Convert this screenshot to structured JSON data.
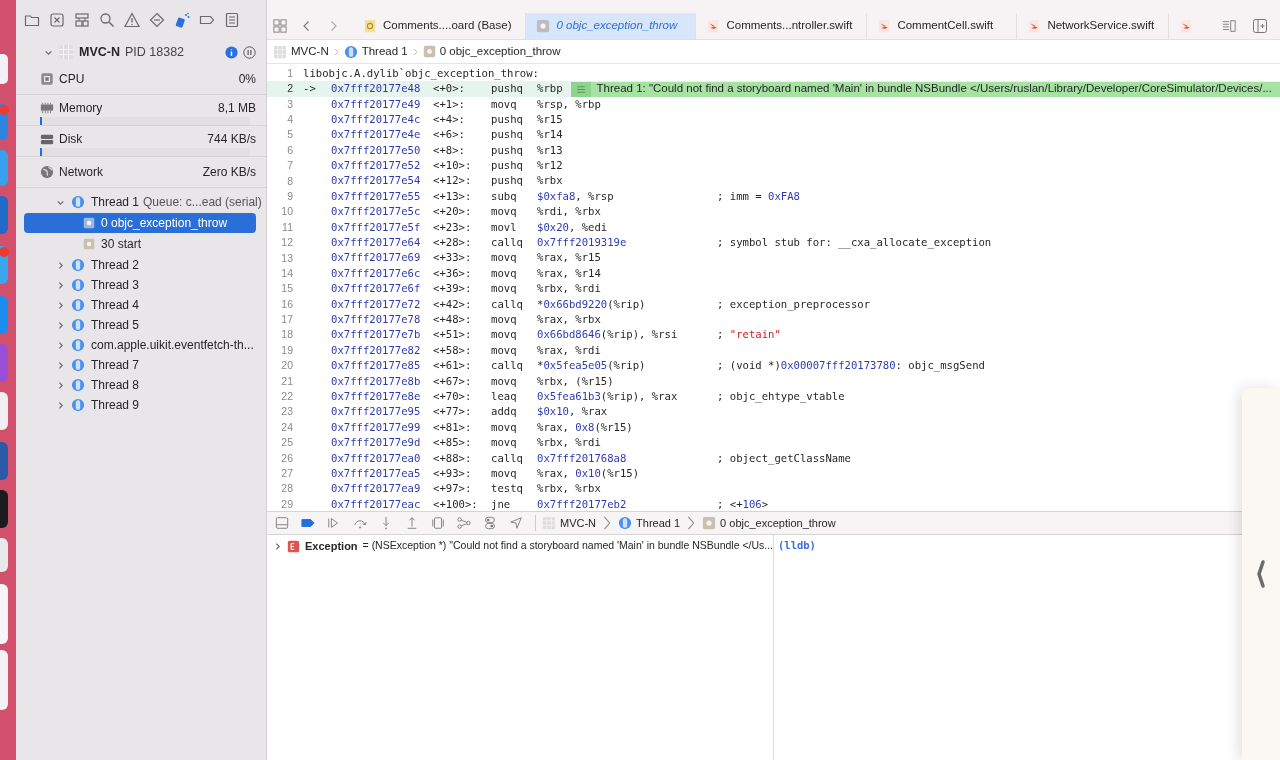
{
  "navigator_icons": [
    {
      "kind": "folder",
      "selected": false
    },
    {
      "kind": "source",
      "selected": false
    },
    {
      "kind": "hierarchy",
      "selected": false
    },
    {
      "kind": "search",
      "selected": false
    },
    {
      "kind": "warning",
      "selected": false
    },
    {
      "kind": "test",
      "selected": false
    },
    {
      "kind": "debug",
      "selected": true
    },
    {
      "kind": "breakpoint",
      "selected": false
    },
    {
      "kind": "report",
      "selected": false
    }
  ],
  "process": {
    "name": "MVC-N",
    "pid": "PID 18382",
    "expanded": true
  },
  "gauges": [
    {
      "kind": "cpu",
      "label": "CPU",
      "value": "0%"
    },
    {
      "kind": "memory",
      "label": "Memory",
      "value": "8,1 MB",
      "level": 0.01
    },
    {
      "kind": "disk",
      "label": "Disk",
      "value": "744 KB/s",
      "level": 0.01
    },
    {
      "kind": "network",
      "label": "Network",
      "value": "Zero KB/s"
    }
  ],
  "threads": [
    {
      "name": "Thread 1",
      "detail": "Queue: c...ead (serial)",
      "expanded": true,
      "children": [
        {
          "label": "0 objc_exception_throw",
          "selected": true
        },
        {
          "label": "30 start",
          "selected": false
        }
      ]
    },
    {
      "name": "Thread 2",
      "expanded": false
    },
    {
      "name": "Thread 3",
      "expanded": false
    },
    {
      "name": "Thread 4",
      "expanded": false
    },
    {
      "name": "Thread 5",
      "expanded": false
    },
    {
      "name": "com.apple.uikit.eventfetch-th...",
      "expanded": false
    },
    {
      "name": "Thread 7",
      "expanded": false
    },
    {
      "name": "Thread 8",
      "expanded": false
    },
    {
      "name": "Thread 9",
      "expanded": false
    }
  ],
  "tabs": [
    {
      "kind": "storyboard",
      "label": "Comments....oard (Base)",
      "selected": false
    },
    {
      "kind": "frame",
      "label": "0 objc_exception_throw",
      "selected": true
    },
    {
      "kind": "swift",
      "label": "Comments...ntroller.swift",
      "selected": false
    },
    {
      "kind": "swift",
      "label": "CommentCell.swift",
      "selected": false
    },
    {
      "kind": "swift",
      "label": "NetworkService.swift",
      "selected": false
    },
    {
      "kind": "swift",
      "selected": false
    }
  ],
  "breadcrumb": [
    "MVC-N",
    "Thread 1",
    "0 objc_exception_throw"
  ],
  "code": {
    "lines": [
      {
        "number": "1",
        "header": "libobjc.A.dylib`objc_exception_throw:"
      },
      {
        "number": "2",
        "current": true,
        "arrow": "->",
        "addr": "0x7fff20177e48",
        "offset": "<+0>:",
        "op": "pushq",
        "args": "%rbp",
        "banner": "Thread 1: \"Could not find a storyboard named 'Main' in bundle NSBundle </Users/ruslan/Library/Developer/CoreSimulator/Devices/..."
      },
      {
        "number": "3",
        "addr": "0x7fff20177e49",
        "offset": "<+1>:",
        "op": "movq",
        "args": "%rsp, %rbp"
      },
      {
        "number": "4",
        "addr": "0x7fff20177e4c",
        "offset": "<+4>:",
        "op": "pushq",
        "args": "%r15"
      },
      {
        "number": "5",
        "addr": "0x7fff20177e4e",
        "offset": "<+6>:",
        "op": "pushq",
        "args": "%r14"
      },
      {
        "number": "6",
        "addr": "0x7fff20177e50",
        "offset": "<+8>:",
        "op": "pushq",
        "args": "%r13"
      },
      {
        "number": "7",
        "addr": "0x7fff20177e52",
        "offset": "<+10>:",
        "op": "pushq",
        "args": "%r12"
      },
      {
        "number": "8",
        "addr": "0x7fff20177e54",
        "offset": "<+12>:",
        "op": "pushq",
        "args": "%rbx"
      },
      {
        "number": "9",
        "addr": "0x7fff20177e55",
        "offset": "<+13>:",
        "op": "subq",
        "args": "$0xfa8, %rsp",
        "comment": "; imm = 0xFA8"
      },
      {
        "number": "10",
        "addr": "0x7fff20177e5c",
        "offset": "<+20>:",
        "op": "movq",
        "args": "%rdi, %rbx"
      },
      {
        "number": "11",
        "addr": "0x7fff20177e5f",
        "offset": "<+23>:",
        "op": "movl",
        "args": "$0x20, %edi"
      },
      {
        "number": "12",
        "addr": "0x7fff20177e64",
        "offset": "<+28>:",
        "op": "callq",
        "args": "0x7fff2019319e",
        "comment": "; symbol stub for: __cxa_allocate_exception"
      },
      {
        "number": "13",
        "addr": "0x7fff20177e69",
        "offset": "<+33>:",
        "op": "movq",
        "args": "%rax, %r15"
      },
      {
        "number": "14",
        "addr": "0x7fff20177e6c",
        "offset": "<+36>:",
        "op": "movq",
        "args": "%rax, %r14"
      },
      {
        "number": "15",
        "addr": "0x7fff20177e6f",
        "offset": "<+39>:",
        "op": "movq",
        "args": "%rbx, %rdi"
      },
      {
        "number": "16",
        "addr": "0x7fff20177e72",
        "offset": "<+42>:",
        "op": "callq",
        "args": "*0x66bd9220(%rip)",
        "comment": "; exception_preprocessor"
      },
      {
        "number": "17",
        "addr": "0x7fff20177e78",
        "offset": "<+48>:",
        "op": "movq",
        "args": "%rax, %rbx"
      },
      {
        "number": "18",
        "addr": "0x7fff20177e7b",
        "offset": "<+51>:",
        "op": "movq",
        "args": "0x66bd8646(%rip), %rsi",
        "comment": "; \"retain\""
      },
      {
        "number": "19",
        "addr": "0x7fff20177e82",
        "offset": "<+58>:",
        "op": "movq",
        "args": "%rax, %rdi"
      },
      {
        "number": "20",
        "addr": "0x7fff20177e85",
        "offset": "<+61>:",
        "op": "callq",
        "args": "*0x5fea5e05(%rip)",
        "comment": "; (void *)0x00007fff20173780: objc_msgSend"
      },
      {
        "number": "21",
        "addr": "0x7fff20177e8b",
        "offset": "<+67>:",
        "op": "movq",
        "args": "%rbx, (%r15)"
      },
      {
        "number": "22",
        "addr": "0x7fff20177e8e",
        "offset": "<+70>:",
        "op": "leaq",
        "args": "0x5fea61b3(%rip), %rax",
        "comment": "; objc_ehtype_vtable"
      },
      {
        "number": "23",
        "addr": "0x7fff20177e95",
        "offset": "<+77>:",
        "op": "addq",
        "args": "$0x10, %rax"
      },
      {
        "number": "24",
        "addr": "0x7fff20177e99",
        "offset": "<+81>:",
        "op": "movq",
        "args": "%rax, 0x8(%r15)"
      },
      {
        "number": "25",
        "addr": "0x7fff20177e9d",
        "offset": "<+85>:",
        "op": "movq",
        "args": "%rbx, %rdi"
      },
      {
        "number": "26",
        "addr": "0x7fff20177ea0",
        "offset": "<+88>:",
        "op": "callq",
        "args": "0x7fff201768a8",
        "comment": "; object_getClassName"
      },
      {
        "number": "27",
        "addr": "0x7fff20177ea5",
        "offset": "<+93>:",
        "op": "movq",
        "args": "%rax, 0x10(%r15)"
      },
      {
        "number": "28",
        "addr": "0x7fff20177ea9",
        "offset": "<+97>:",
        "op": "testq",
        "args": "%rbx, %rbx"
      },
      {
        "number": "29",
        "addr": "0x7fff20177eac",
        "offset": "<+100>:",
        "op": "jne",
        "args": "0x7fff20177eb2",
        "comment": "; <+106>"
      }
    ]
  },
  "debug_bar": {
    "breakpoints_active": true,
    "breadcrumb": [
      "MVC-N",
      "Thread 1",
      "0 objc_exception_throw"
    ]
  },
  "variables": [
    {
      "name": "Exception",
      "value": "= (NSException *) \"Could not find a storyboard named 'Main' in bundle NSBundle </Us...",
      "expanded": false
    }
  ],
  "console": {
    "prompt": "(lldb)"
  }
}
